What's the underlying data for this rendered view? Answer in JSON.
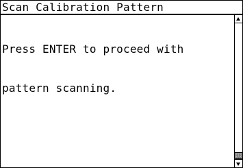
{
  "window": {
    "title": "Scan Calibration Pattern"
  },
  "content": {
    "message_lines": [
      "Press ENTER to proceed with",
      "pattern scanning."
    ]
  },
  "scrollbar": {
    "up_icon": "arrow-up-icon",
    "down_icon": "arrow-down-icon",
    "position_fraction": 1.0
  }
}
